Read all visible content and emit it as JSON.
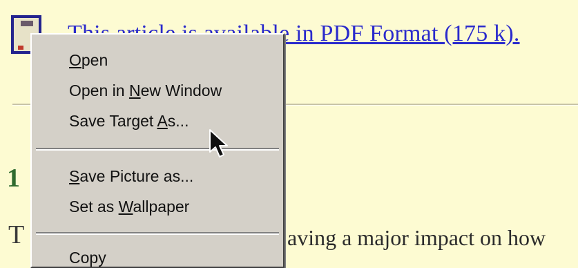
{
  "page": {
    "pdf_link_text": "This article is available in PDF Format (175 k).",
    "heading_number": "1",
    "body_first_letter": "T",
    "body_visible_text": "aving a major impact on how"
  },
  "context_menu": {
    "items": [
      {
        "pre": "",
        "mnemonic": "O",
        "post": "pen"
      },
      {
        "pre": "Open in ",
        "mnemonic": "N",
        "post": "ew Window"
      },
      {
        "pre": "Save Target ",
        "mnemonic": "A",
        "post": "s..."
      },
      {
        "pre": "",
        "mnemonic": "S",
        "post": "ave Picture as..."
      },
      {
        "pre": "Set as ",
        "mnemonic": "W",
        "post": "allpaper"
      },
      {
        "pre": "",
        "mnemonic": "",
        "post": "Copy"
      }
    ]
  },
  "icons": {
    "pdf": "pdf-document-icon",
    "cursor": "arrow-cursor-icon"
  },
  "colors": {
    "page_background": "#fdfbd2",
    "link": "#2a2acc",
    "heading": "#2f6b2f",
    "menu_background": "#d4d0c8"
  }
}
